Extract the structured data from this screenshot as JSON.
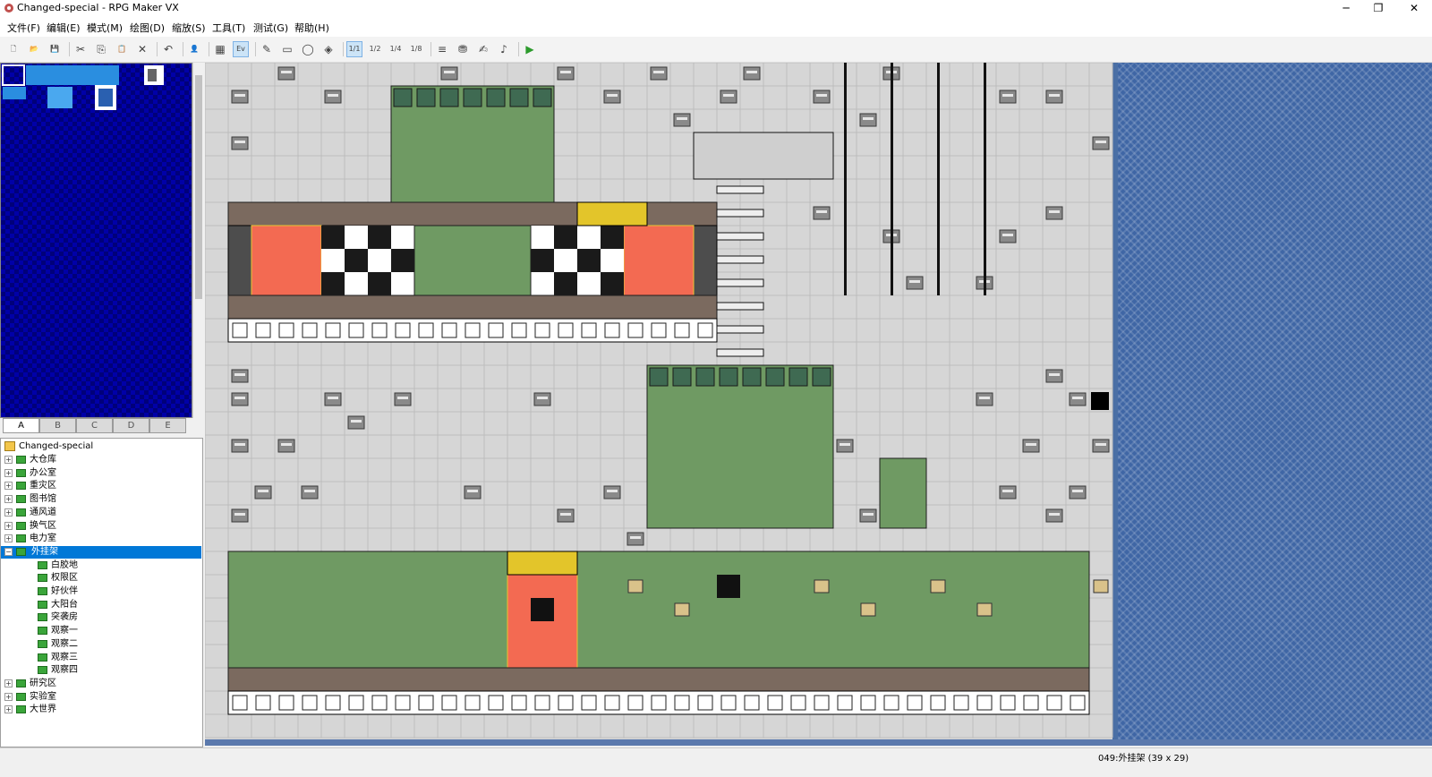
{
  "window": {
    "title": "Changed-special - RPG Maker VX",
    "minimize": "─",
    "maximize": "❐",
    "close": "✕"
  },
  "menu": [
    {
      "label": "文件(F)"
    },
    {
      "label": "编辑(E)"
    },
    {
      "label": "模式(M)"
    },
    {
      "label": "绘图(D)"
    },
    {
      "label": "缩放(S)"
    },
    {
      "label": "工具(T)"
    },
    {
      "label": "测试(G)"
    },
    {
      "label": "帮助(H)"
    }
  ],
  "toolbar": [
    {
      "icon": "new-project-icon",
      "glyph": "🗋"
    },
    {
      "icon": "open-project-icon",
      "glyph": "📂"
    },
    {
      "icon": "save-icon",
      "glyph": "💾"
    },
    {
      "sep": true
    },
    {
      "icon": "cut-icon",
      "glyph": "✂"
    },
    {
      "icon": "copy-icon",
      "glyph": "⎘"
    },
    {
      "icon": "paste-icon",
      "glyph": "📋"
    },
    {
      "icon": "delete-icon",
      "glyph": "✕"
    },
    {
      "sep": true
    },
    {
      "icon": "undo-icon",
      "glyph": "↶"
    },
    {
      "sep": true
    },
    {
      "icon": "event-mode-icon",
      "glyph": "👤"
    },
    {
      "sep": true
    },
    {
      "icon": "map-mode-icon",
      "glyph": "▦"
    },
    {
      "icon": "event-layer-icon",
      "glyph": "Ev",
      "active": true
    },
    {
      "sep": true
    },
    {
      "icon": "pencil-icon",
      "glyph": "✎"
    },
    {
      "icon": "rectangle-icon",
      "glyph": "▭"
    },
    {
      "icon": "ellipse-icon",
      "glyph": "◯"
    },
    {
      "icon": "fill-icon",
      "glyph": "◈"
    },
    {
      "sep": true
    },
    {
      "icon": "zoom-1-1-icon",
      "glyph": "1/1",
      "active": true
    },
    {
      "icon": "zoom-1-2-icon",
      "glyph": "1/2"
    },
    {
      "icon": "zoom-1-4-icon",
      "glyph": "1/4"
    },
    {
      "icon": "zoom-1-8-icon",
      "glyph": "1/8"
    },
    {
      "sep": true
    },
    {
      "icon": "database-icon",
      "glyph": "≡"
    },
    {
      "icon": "materials-icon",
      "glyph": "⛃"
    },
    {
      "icon": "script-editor-icon",
      "glyph": "✍"
    },
    {
      "icon": "sound-test-icon",
      "glyph": "♪"
    },
    {
      "sep": true
    },
    {
      "icon": "playtest-icon",
      "glyph": "▶"
    }
  ],
  "tileset_tabs": [
    "A",
    "B",
    "C",
    "D",
    "E"
  ],
  "tree": {
    "root": "Changed-special",
    "items": [
      {
        "label": "大仓库",
        "level": 1,
        "expandable": true,
        "expanded": false
      },
      {
        "label": "办公室",
        "level": 1,
        "expandable": true,
        "expanded": false
      },
      {
        "label": "重灾区",
        "level": 1,
        "expandable": true,
        "expanded": false
      },
      {
        "label": "图书馆",
        "level": 1,
        "expandable": true,
        "expanded": false
      },
      {
        "label": "通风道",
        "level": 1,
        "expandable": true,
        "expanded": false
      },
      {
        "label": "换气区",
        "level": 1,
        "expandable": true,
        "expanded": false
      },
      {
        "label": "电力室",
        "level": 1,
        "expandable": true,
        "expanded": false
      },
      {
        "label": "外挂架",
        "level": 1,
        "expandable": true,
        "expanded": true,
        "selected": true
      },
      {
        "label": "白胶地",
        "level": 2,
        "expandable": false
      },
      {
        "label": "权限区",
        "level": 2,
        "expandable": false
      },
      {
        "label": "好伙伴",
        "level": 2,
        "expandable": false
      },
      {
        "label": "大阳台",
        "level": 2,
        "expandable": false
      },
      {
        "label": "突袭房",
        "level": 2,
        "expandable": false
      },
      {
        "label": "观察一",
        "level": 2,
        "expandable": false
      },
      {
        "label": "观察二",
        "level": 2,
        "expandable": false
      },
      {
        "label": "观察三",
        "level": 2,
        "expandable": false
      },
      {
        "label": "观察四",
        "level": 2,
        "expandable": false
      },
      {
        "label": "研究区",
        "level": 1,
        "expandable": true,
        "expanded": false
      },
      {
        "label": "实验室",
        "level": 1,
        "expandable": true,
        "expanded": false
      },
      {
        "label": "大世界",
        "level": 1,
        "expandable": true,
        "expanded": false
      }
    ]
  },
  "status": {
    "map_info": "049:外挂架 (39 x 29)"
  },
  "colors": {
    "grid_floor": "#d6d6d6",
    "grid_line": "#bdbdbd",
    "grass": "#6f9a63",
    "dark_tile": "#555555",
    "orange_pad": "#f36a52",
    "palette_bg": "#000090",
    "selection": "#0078d7"
  },
  "map": {
    "rows": [
      ".................w......................",
      "..w..........................w...........",
      "........................................",
      ".........GGGGGGG........................",
      "..k......GGGGGGG...........k............",
      ".........GGGGGGG.........L..............",
      ".........GGGGGGG.........L..............",
      "........................................",
      "..k......GGGGGGG.......................w",
      "rbbbbbbbbbbbbbbbbbbbbbbbbbb.........................",
      "rbOOkCCGGGGGGCCCOObb.........................",
      "rbOOkCCGGGGGGCCCOObb.........................",
      "rbOOkCCGGGGGGCCCOObb.........................",
      "tbbbbbbbbbbbbbbbbbbbt...................",
      "hwwwwwwwwwwwwwwwwwwwh...................",
      "........................................",
      "............................GGGGGGGG....",
      "............................GGGGGGGG...K",
      "............................GGGGGGGG....",
      "............................GGGGGGGG....",
      "............................GGGGGGGGGG..",
      "............................GGGGGGGGGG..",
      "........................................",
      "rGGGGGGGGGGGOOGGGGGGGGGGGGGGGGGGGGGGGGGr",
      "rGGGGGGGGGGGOOGGGGGGGGGGGGGGGGGGGGGGGGGr",
      "rGGGGGGGGGGGOOGGGGGGGGGGGGGGGGGGGGGGGGGr",
      "rGGGGGGGGGGGOOGGGGGGGGGGGGGGGGGGGGGGGGGr",
      "rGGGGGGGGGGGOOGGGGGGGGGGGGGGGGGGGGGGGGGr",
      "tbbbbbbbbbbbbbbbbbbbbbbbbbbbbbbbbbbbbbbt",
      "hwwwwwwwwwwwwwwwwwwwwwwwwwwwwwwwwwwwwwwh"
    ]
  }
}
